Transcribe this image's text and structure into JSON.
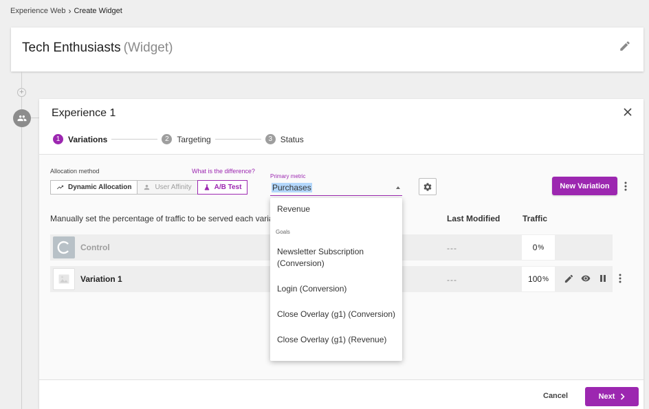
{
  "breadcrumb": {
    "parent": "Experience Web",
    "separator": "›",
    "current": "Create Widget"
  },
  "header": {
    "title": "Tech Enthusiasts",
    "subtitle": "(Widget)"
  },
  "timeline": {
    "plus": "+"
  },
  "experience": {
    "title": "Experience 1",
    "steps": [
      {
        "num": "1",
        "label": "Variations"
      },
      {
        "num": "2",
        "label": "Targeting"
      },
      {
        "num": "3",
        "label": "Status"
      }
    ]
  },
  "allocation": {
    "label": "Allocation method",
    "difference_link": "What is the difference?",
    "options": [
      "Dynamic Allocation",
      "User Affinity",
      "A/B Test"
    ],
    "selected": "A/B Test"
  },
  "primary_metric": {
    "label": "Primary metric",
    "value": "Purchases",
    "dropdown": {
      "first": "Revenue",
      "group": "Goals",
      "items": [
        "Newsletter Subscription (Conversion)",
        "Login (Conversion)",
        "Close Overlay (g1) (Conversion)",
        "Close Overlay (g1) (Revenue)"
      ]
    }
  },
  "new_variation_label": "New Variation",
  "table": {
    "description": "Manually set the percentage of traffic to be served each variation",
    "col_last_modified": "Last Modified",
    "col_traffic": "Traffic",
    "rows": [
      {
        "name": "Control",
        "last_modified": "---",
        "traffic": "0",
        "unit": "%"
      },
      {
        "name": "Variation 1",
        "last_modified": "---",
        "traffic": "100",
        "unit": "%"
      }
    ]
  },
  "footer": {
    "cancel": "Cancel",
    "next": "Next"
  },
  "colors": {
    "accent": "#9c27b0",
    "selection": "#b3d7fb"
  }
}
